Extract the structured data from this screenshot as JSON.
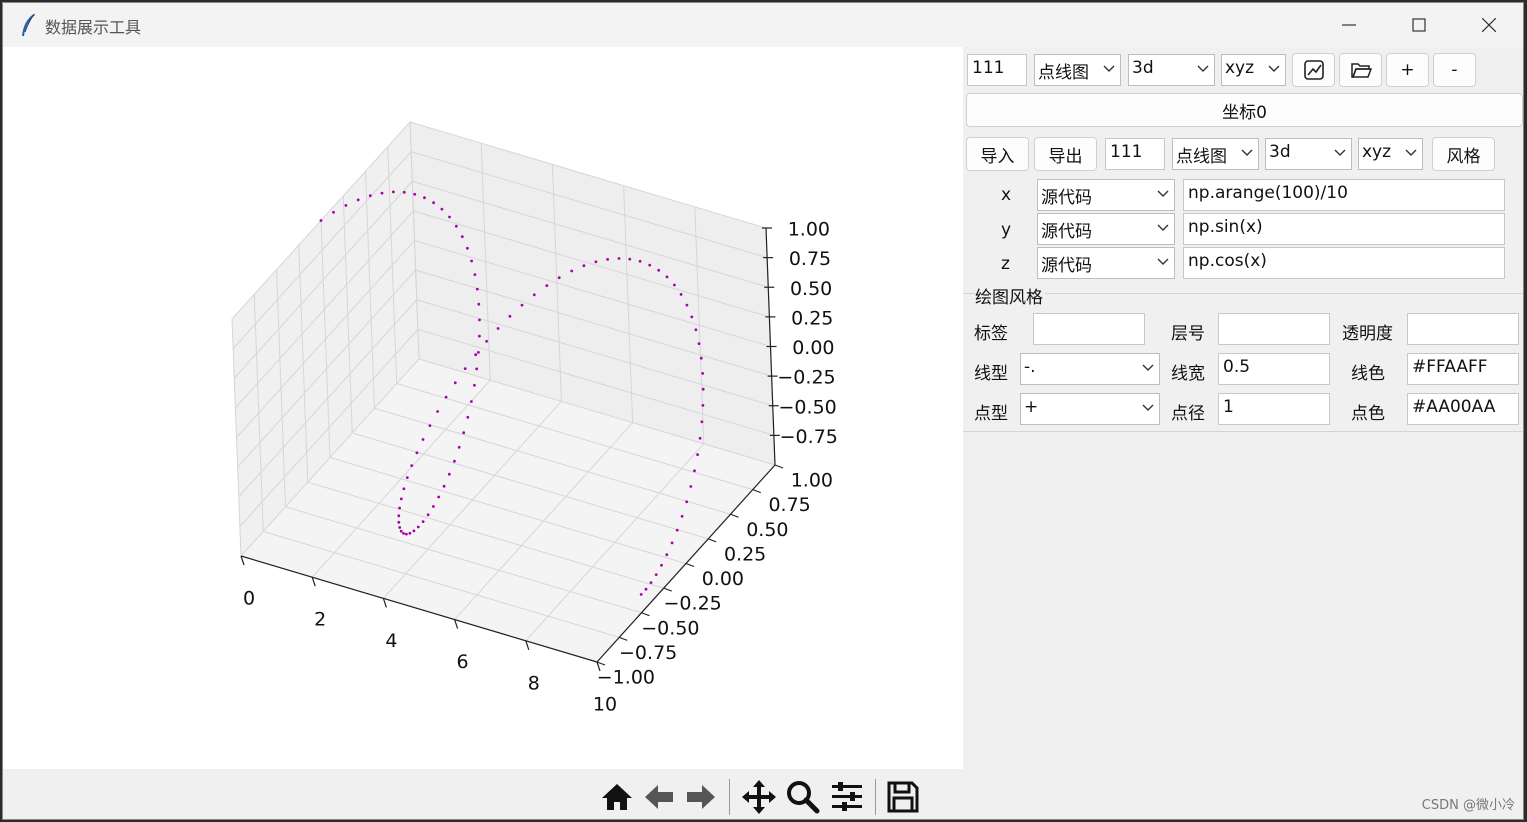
{
  "window": {
    "title": "数据展示工具"
  },
  "topbar": {
    "subplot": "111",
    "plot_type": "点线图",
    "dimension": "3d",
    "axes": "xyz",
    "add_label": "+",
    "remove_label": "-"
  },
  "coord_button": "坐标0",
  "row2": {
    "import_label": "导入",
    "export_label": "导出",
    "subplot": "111",
    "plot_type": "点线图",
    "dimension": "3d",
    "axes": "xyz",
    "style_label": "风格"
  },
  "data_rows": [
    {
      "axis": "x",
      "source": "源代码",
      "expr": "np.arange(100)/10"
    },
    {
      "axis": "y",
      "source": "源代码",
      "expr": "np.sin(x)"
    },
    {
      "axis": "z",
      "source": "源代码",
      "expr": "np.cos(x)"
    }
  ],
  "style_section": {
    "title": "绘图风格",
    "label_label": "标签",
    "label_value": "",
    "layer_label": "层号",
    "layer_value": "",
    "alpha_label": "透明度",
    "alpha_value": "",
    "linestyle_label": "线型",
    "linestyle_value": "-.",
    "linewidth_label": "线宽",
    "linewidth_value": "0.5",
    "linecolor_label": "线色",
    "linecolor_value": "#FFAAFF",
    "marker_label": "点型",
    "marker_value": "+",
    "markersize_label": "点径",
    "markersize_value": "1",
    "markercolor_label": "点色",
    "markercolor_value": "#AA00AA"
  },
  "chart_data": {
    "type": "scatter",
    "projection": "3d",
    "x_expr": "np.arange(100)/10",
    "y_expr": "np.sin(x)",
    "z_expr": "np.cos(x)",
    "n_points": 100,
    "marker_color": "#AA00AA",
    "x_ticks": [
      "0",
      "2",
      "4",
      "6",
      "8",
      "10"
    ],
    "y_ticks": [
      "1.00",
      "0.75",
      "0.50",
      "0.25",
      "0.00",
      "−0.25",
      "−0.50",
      "−0.75",
      "−1.00"
    ],
    "z_ticks": [
      "1.00",
      "0.75",
      "0.50",
      "0.25",
      "0.00",
      "−0.25",
      "−0.50",
      "−0.75"
    ],
    "xlim": [
      0,
      10
    ],
    "ylim": [
      -1,
      1
    ],
    "zlim": [
      -1,
      1
    ],
    "grid": true
  },
  "watermark": "CSDN @微小冷"
}
